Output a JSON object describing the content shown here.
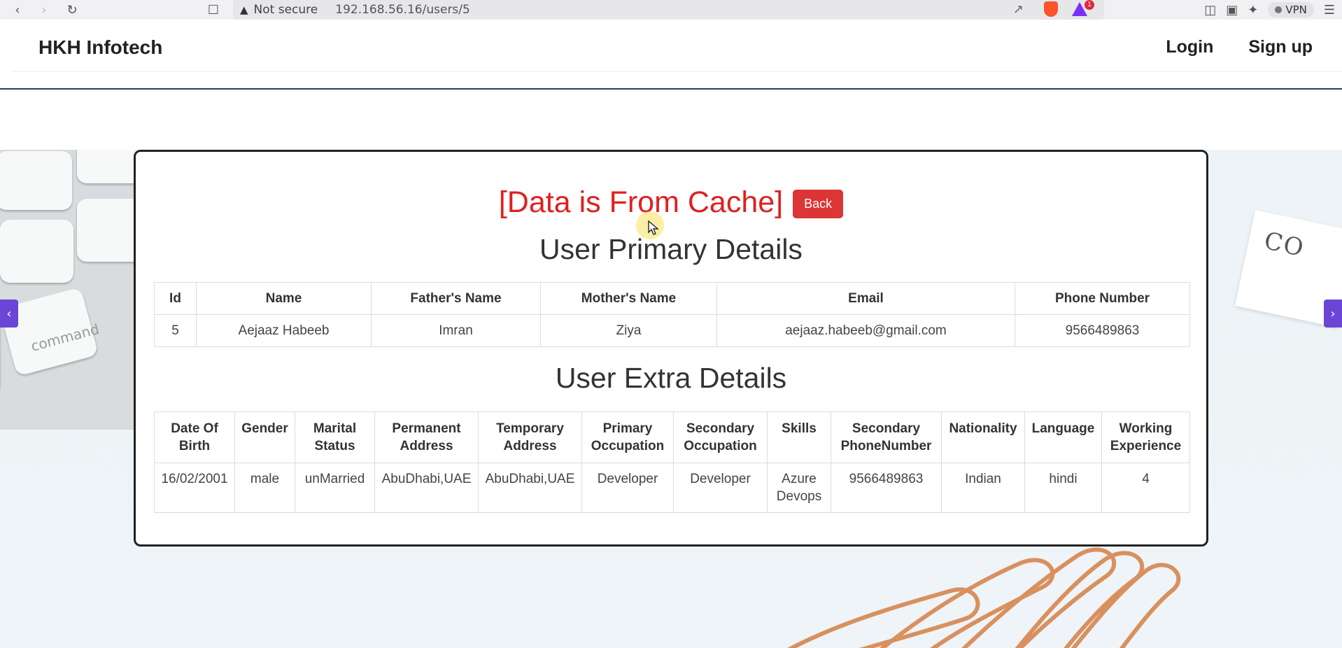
{
  "browser": {
    "security_label": "Not secure",
    "url": "192.168.56.16/users/5",
    "rewards_badge": "1",
    "vpn_label": "VPN"
  },
  "navbar": {
    "brand": "HKH Infotech",
    "links": [
      "Login",
      "Sign up"
    ]
  },
  "card": {
    "cache_message": "[Data is From Cache]",
    "back_label": "Back",
    "primary_title": "User Primary Details",
    "extra_title": "User Extra Details"
  },
  "primary_table": {
    "headers": [
      "Id",
      "Name",
      "Father's Name",
      "Mother's Name",
      "Email",
      "Phone Number"
    ],
    "rows": [
      [
        "5",
        "Aejaaz Habeeb",
        "Imran",
        "Ziya",
        "aejaaz.habeeb@gmail.com",
        "9566489863"
      ]
    ]
  },
  "extra_table": {
    "headers": [
      "Date Of Birth",
      "Gender",
      "Marital Status",
      "Permanent Address",
      "Temporary Address",
      "Primary Occupation",
      "Secondary Occupation",
      "Skills",
      "Secondary PhoneNumber",
      "Nationality",
      "Language",
      "Working Experience"
    ],
    "rows": [
      [
        "16/02/2001",
        "male",
        "unMarried",
        "AbuDhabi,UAE",
        "AbuDhabi,UAE",
        "Developer",
        "Developer",
        "Azure Devops",
        "9566489863",
        "Indian",
        "hindi",
        "4"
      ]
    ]
  },
  "background": {
    "card_text": "CO",
    "keyboard_key": "command"
  },
  "colors": {
    "cache_red": "#e02020",
    "back_button": "#dc3535",
    "carousel_arrow": "#6b45d6",
    "nav_underline": "#1d3f66"
  }
}
